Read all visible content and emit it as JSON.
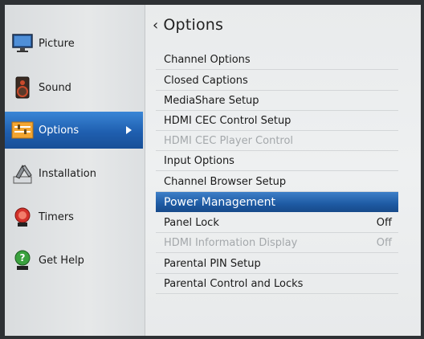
{
  "sidebar": {
    "items": [
      {
        "label": "Picture",
        "icon": "monitor-icon"
      },
      {
        "label": "Sound",
        "icon": "speaker-icon"
      },
      {
        "label": "Options",
        "icon": "options-icon",
        "active": true
      },
      {
        "label": "Installation",
        "icon": "tools-icon"
      },
      {
        "label": "Timers",
        "icon": "alarm-icon"
      },
      {
        "label": "Get Help",
        "icon": "help-icon"
      }
    ]
  },
  "panel": {
    "title": "Options",
    "items": [
      {
        "label": "Channel Options",
        "value": ""
      },
      {
        "label": "Closed Captions",
        "value": ""
      },
      {
        "label": "MediaShare Setup",
        "value": ""
      },
      {
        "label": "HDMI CEC Control Setup",
        "value": ""
      },
      {
        "label": "HDMI CEC Player Control",
        "value": "",
        "disabled": true
      },
      {
        "label": "Input Options",
        "value": ""
      },
      {
        "label": "Channel Browser Setup",
        "value": ""
      },
      {
        "label": "Power Management",
        "value": "",
        "selected": true
      },
      {
        "label": "Panel Lock",
        "value": "Off"
      },
      {
        "label": "HDMI Information Display",
        "value": "Off",
        "disabled": true
      },
      {
        "label": "Parental PIN Setup",
        "value": ""
      },
      {
        "label": "Parental Control and Locks",
        "value": ""
      }
    ]
  },
  "colors": {
    "accent": "#1f5fb0",
    "disabled_text": "#a4a8ab",
    "background": "#e9ebec"
  }
}
